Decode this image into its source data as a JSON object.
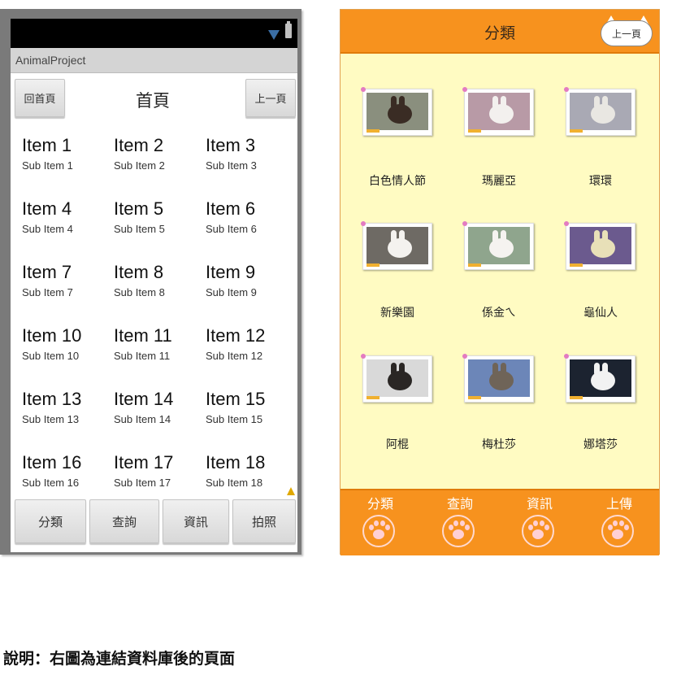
{
  "left_app": {
    "app_title": "AnimalProject",
    "header": {
      "home_button": "回首頁",
      "title": "首頁",
      "back_button": "上一頁"
    },
    "items": [
      {
        "title": "Item 1",
        "sub": "Sub Item 1"
      },
      {
        "title": "Item 2",
        "sub": "Sub Item 2"
      },
      {
        "title": "Item 3",
        "sub": "Sub Item 3"
      },
      {
        "title": "Item 4",
        "sub": "Sub Item 4"
      },
      {
        "title": "Item 5",
        "sub": "Sub Item 5"
      },
      {
        "title": "Item 6",
        "sub": "Sub Item 6"
      },
      {
        "title": "Item 7",
        "sub": "Sub Item 7"
      },
      {
        "title": "Item 8",
        "sub": "Sub Item 8"
      },
      {
        "title": "Item 9",
        "sub": "Sub Item 9"
      },
      {
        "title": "Item 10",
        "sub": "Sub Item 10"
      },
      {
        "title": "Item 11",
        "sub": "Sub Item 11"
      },
      {
        "title": "Item 12",
        "sub": "Sub Item 12"
      },
      {
        "title": "Item 13",
        "sub": "Sub Item 13"
      },
      {
        "title": "Item 14",
        "sub": "Sub Item 14"
      },
      {
        "title": "Item 15",
        "sub": "Sub Item 15"
      },
      {
        "title": "Item 16",
        "sub": "Sub Item 16"
      },
      {
        "title": "Item 17",
        "sub": "Sub Item 17"
      },
      {
        "title": "Item 18",
        "sub": "Sub Item 18"
      }
    ],
    "bottom_buttons": [
      "分類",
      "查詢",
      "資訊",
      "拍照"
    ],
    "status_icons": [
      "wifi-icon",
      "battery-icon",
      "warning-icon"
    ]
  },
  "right_app": {
    "title": "分類",
    "back_button": "上一頁",
    "animals": [
      {
        "name": "白色情人節",
        "colors": {
          "bg": "#8a8f7e",
          "bunny": "#3a2c24",
          "ear": "#3a2c24"
        }
      },
      {
        "name": "瑪麗亞",
        "colors": {
          "bg": "#b89aa6",
          "bunny": "#f3f0ee",
          "ear": "#f3f0ee"
        }
      },
      {
        "name": "環環",
        "colors": {
          "bg": "#a9a9b4",
          "bunny": "#e9e7e2",
          "ear": "#e9e7e2"
        }
      },
      {
        "name": "新樂園",
        "colors": {
          "bg": "#6e6a64",
          "bunny": "#f4f2ef",
          "ear": "#f4f2ef"
        }
      },
      {
        "name": "係金ㄟ",
        "colors": {
          "bg": "#8fa58d",
          "bunny": "#f5f3f0",
          "ear": "#f5f3f0"
        }
      },
      {
        "name": "龜仙人",
        "colors": {
          "bg": "#6b5a8e",
          "bunny": "#e8e0b8",
          "ear": "#e8e0b8"
        }
      },
      {
        "name": "阿棍",
        "colors": {
          "bg": "#d9d9d9",
          "bunny": "#2a2624",
          "ear": "#2a2624"
        }
      },
      {
        "name": "梅杜莎",
        "colors": {
          "bg": "#6c86b8",
          "bunny": "#6f6458",
          "ear": "#6f6458"
        }
      },
      {
        "name": "娜塔莎",
        "colors": {
          "bg": "#1c2330",
          "bunny": "#f2f2f2",
          "ear": "#f2f2f2"
        }
      }
    ],
    "tabs": [
      "分類",
      "查詢",
      "資訊",
      "上傳"
    ],
    "colors": {
      "accent": "#f7921e",
      "background": "#fffbc2",
      "paw": "#ffd0d4"
    }
  },
  "caption": "說明：右圖為連結資料庫後的頁面"
}
